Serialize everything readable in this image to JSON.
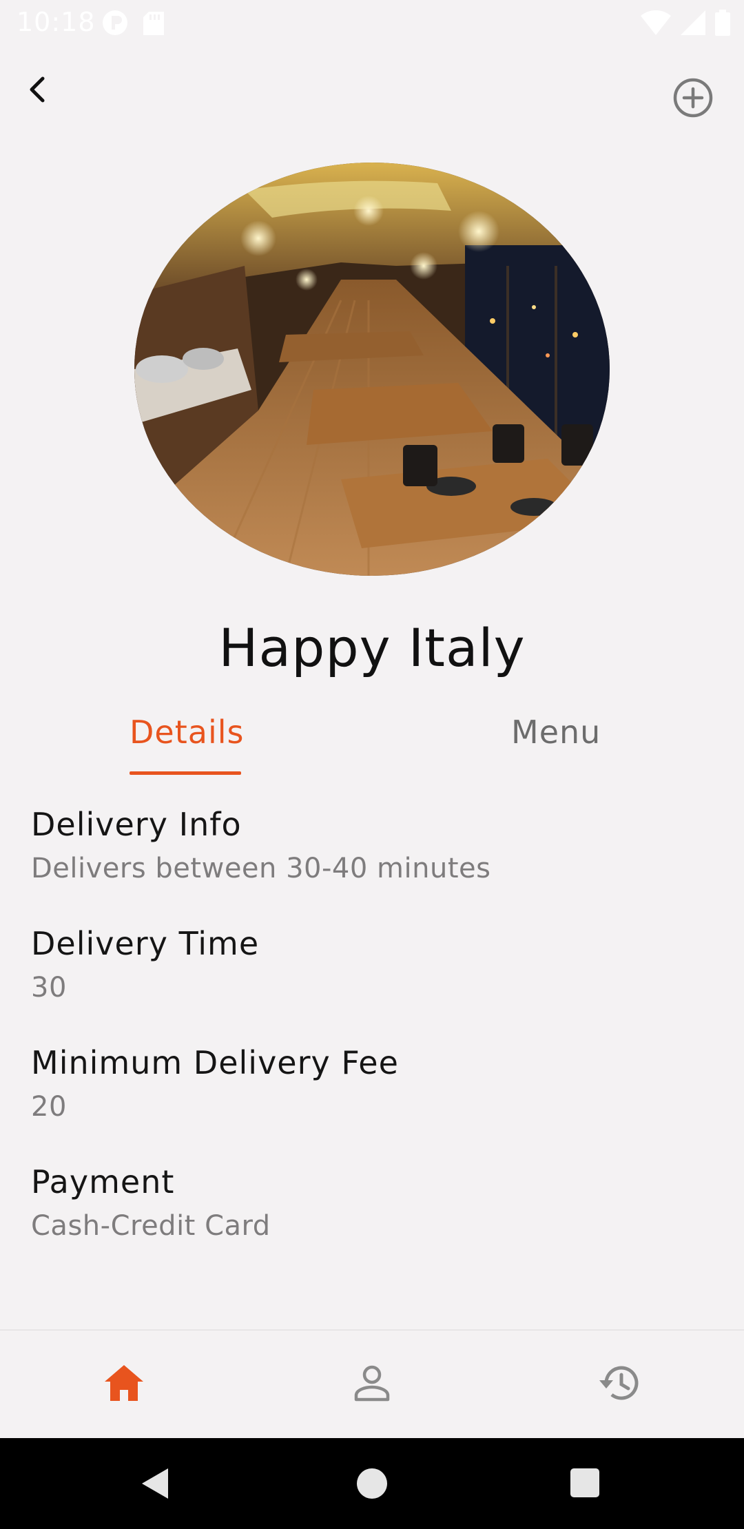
{
  "status_bar": {
    "time": "10:18",
    "icons_left": [
      "app-notification-icon",
      "sd-card-icon"
    ],
    "icons_right": [
      "wifi-icon",
      "signal-icon",
      "battery-icon"
    ]
  },
  "app_bar": {
    "back_icon": "chevron-left-icon",
    "add_icon": "add-circle-icon"
  },
  "restaurant": {
    "name": "Happy Italy",
    "image_icon": "restaurant-photo"
  },
  "tabs": {
    "items": [
      {
        "label": "Details",
        "active": true
      },
      {
        "label": "Menu",
        "active": false
      }
    ],
    "active_color": "#e8541e",
    "inactive_color": "#6c6c6c"
  },
  "details": [
    {
      "title": "Delivery Info",
      "value": "Delivers between 30-40 minutes"
    },
    {
      "title": "Delivery Time",
      "value": "30"
    },
    {
      "title": "Minimum Delivery Fee",
      "value": "20"
    },
    {
      "title": "Payment",
      "value": "Cash-Credit Card"
    }
  ],
  "bottom_nav": {
    "items": [
      {
        "icon": "home-icon",
        "active": true
      },
      {
        "icon": "person-icon",
        "active": false
      },
      {
        "icon": "history-icon",
        "active": false
      }
    ],
    "active_color": "#e8541e",
    "inactive_color": "#8a8a8a"
  },
  "system_nav": {
    "icons": [
      "system-back-icon",
      "system-home-icon",
      "system-recents-icon"
    ]
  }
}
